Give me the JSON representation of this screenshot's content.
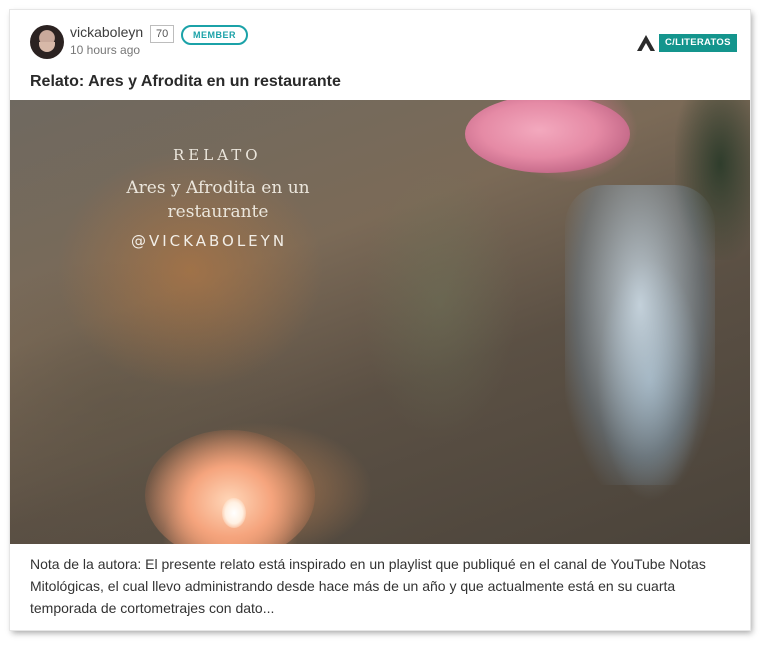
{
  "post": {
    "author": {
      "username": "vickaboleyn",
      "score": "70",
      "badge": "MEMBER",
      "avatar_icon": "user-avatar"
    },
    "timestamp": "10 hours ago",
    "community": {
      "label": "C/LITERATOS",
      "icon": "community-logo-icon",
      "color": "#14958d"
    },
    "title": "Relato: Ares y Afrodita en un restaurante",
    "image": {
      "label": "RELATO",
      "subtitle": "Ares y Afrodita en un restaurante",
      "handle": "@VICKABOLEYN"
    },
    "excerpt": "Nota de la autora: El presente relato está inspirado en un playlist que publiqué en el canal de YouTube Notas Mitológicas, el cual llevo administrando desde hace más de un año y que actualmente está en su cuarta temporada de cortometrajes con dato..."
  }
}
